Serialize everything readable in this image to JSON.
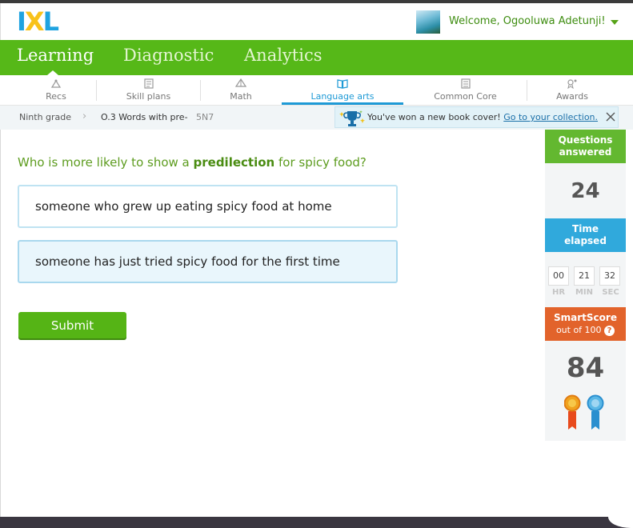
{
  "header": {
    "logo": "IXL",
    "welcome": "Welcome, Ogooluwa Adetunji!"
  },
  "main_nav": {
    "tabs": [
      {
        "label": "Learning",
        "active": true
      },
      {
        "label": "Diagnostic",
        "active": false
      },
      {
        "label": "Analytics",
        "active": false
      }
    ]
  },
  "subject_tabs": [
    {
      "label": "Recs",
      "icon": "recs-icon"
    },
    {
      "label": "Skill plans",
      "icon": "skill-plans-icon"
    },
    {
      "label": "Math",
      "icon": "math-icon"
    },
    {
      "label": "Language arts",
      "icon": "book-icon",
      "active": true
    },
    {
      "label": "Common Core",
      "icon": "common-core-icon"
    },
    {
      "label": "Awards",
      "icon": "awards-icon"
    }
  ],
  "breadcrumb": {
    "grade": "Ninth grade",
    "skill": "O.3 Words with pre-",
    "code": "5N7"
  },
  "notice": {
    "text": "You've won a new book cover!",
    "link": "Go to your collection."
  },
  "question": {
    "prefix": "Who is more likely to show a ",
    "keyword": "predilection",
    "suffix": " for spicy food?",
    "choices": [
      {
        "text": "someone who grew up eating spicy food at home",
        "selected": false
      },
      {
        "text": "someone has just tried spicy food for the first time",
        "selected": true
      }
    ],
    "submit_label": "Submit"
  },
  "sidebar": {
    "questions_label_1": "Questions",
    "questions_label_2": "answered",
    "questions_value": "24",
    "time_label_1": "Time",
    "time_label_2": "elapsed",
    "time": {
      "hr": "00",
      "min": "21",
      "sec": "32"
    },
    "time_units": {
      "hr": "HR",
      "min": "MIN",
      "sec": "SEC"
    },
    "smartscore_label": "SmartScore",
    "smartscore_sub": "out of 100",
    "smartscore_help": "?",
    "smartscore_value": "84"
  },
  "colors": {
    "brand_green": "#56b818",
    "accent_blue": "#1e9ad6",
    "smartscore_orange": "#e2632b"
  }
}
